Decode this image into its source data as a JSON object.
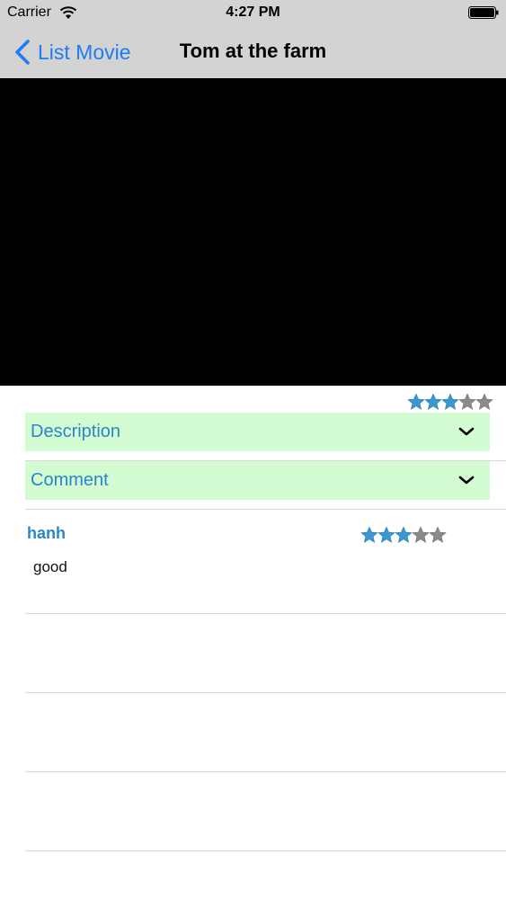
{
  "status_bar": {
    "carrier": "Carrier",
    "time": "4:27 PM",
    "wifi_icon": "wifi-icon",
    "battery_icon": "battery-icon"
  },
  "nav": {
    "back_label": "List Movie",
    "back_icon": "chevron-left-icon",
    "title": "Tom at the farm"
  },
  "movie": {
    "rating": 3,
    "rating_max": 5
  },
  "sections": [
    {
      "label": "Description",
      "icon": "chevron-down-icon"
    },
    {
      "label": "Comment",
      "icon": "chevron-down-icon"
    }
  ],
  "comments": [
    {
      "user": "hanh",
      "text": "good",
      "rating": 3,
      "rating_max": 5
    }
  ],
  "colors": {
    "bar_bg": "#d3d3d3",
    "accent": "#1e7cf4",
    "section_bg": "#d3fcd3",
    "section_text": "#2a86c8",
    "star_filled": "#3c96d0",
    "star_empty": "#8a8a8a"
  }
}
